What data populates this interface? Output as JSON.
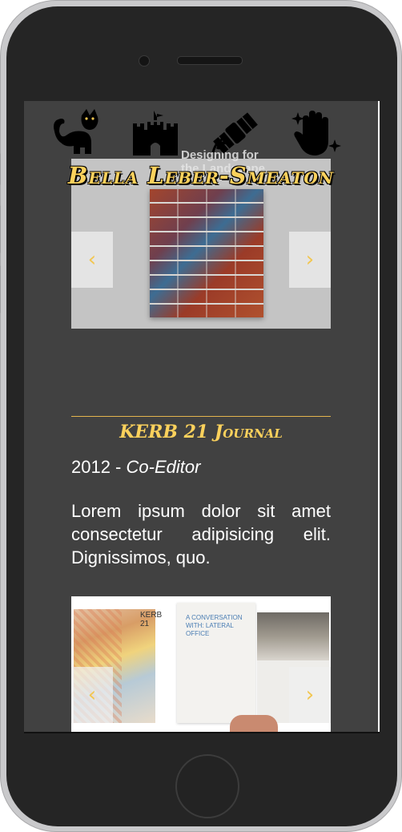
{
  "site": {
    "title": "Bella Leber-Smeaton",
    "nav_icons": [
      "cat-icon",
      "castle-icon",
      "satellite-icon",
      "sparkle-hand-icon"
    ]
  },
  "carousel_top": {
    "cover_text": "Designing for the Landscape.",
    "prev_label": "‹",
    "next_label": "›"
  },
  "project": {
    "title": "KERB 21 Journal",
    "year": "2012 - ",
    "role": "Co-Editor",
    "description": "Lorem ipsum dolor sit amet consectetur adipisicing elit. Dignissimos, quo."
  },
  "carousel_bottom": {
    "spread_text": "A CONVERSATION WITH: LATERAL OFFICE",
    "spine_text": "KERB 21",
    "prev_label": "‹",
    "next_label": "›"
  },
  "colors": {
    "accent": "#fbd15c",
    "screen_bg": "#414141",
    "text": "#ffffff"
  }
}
